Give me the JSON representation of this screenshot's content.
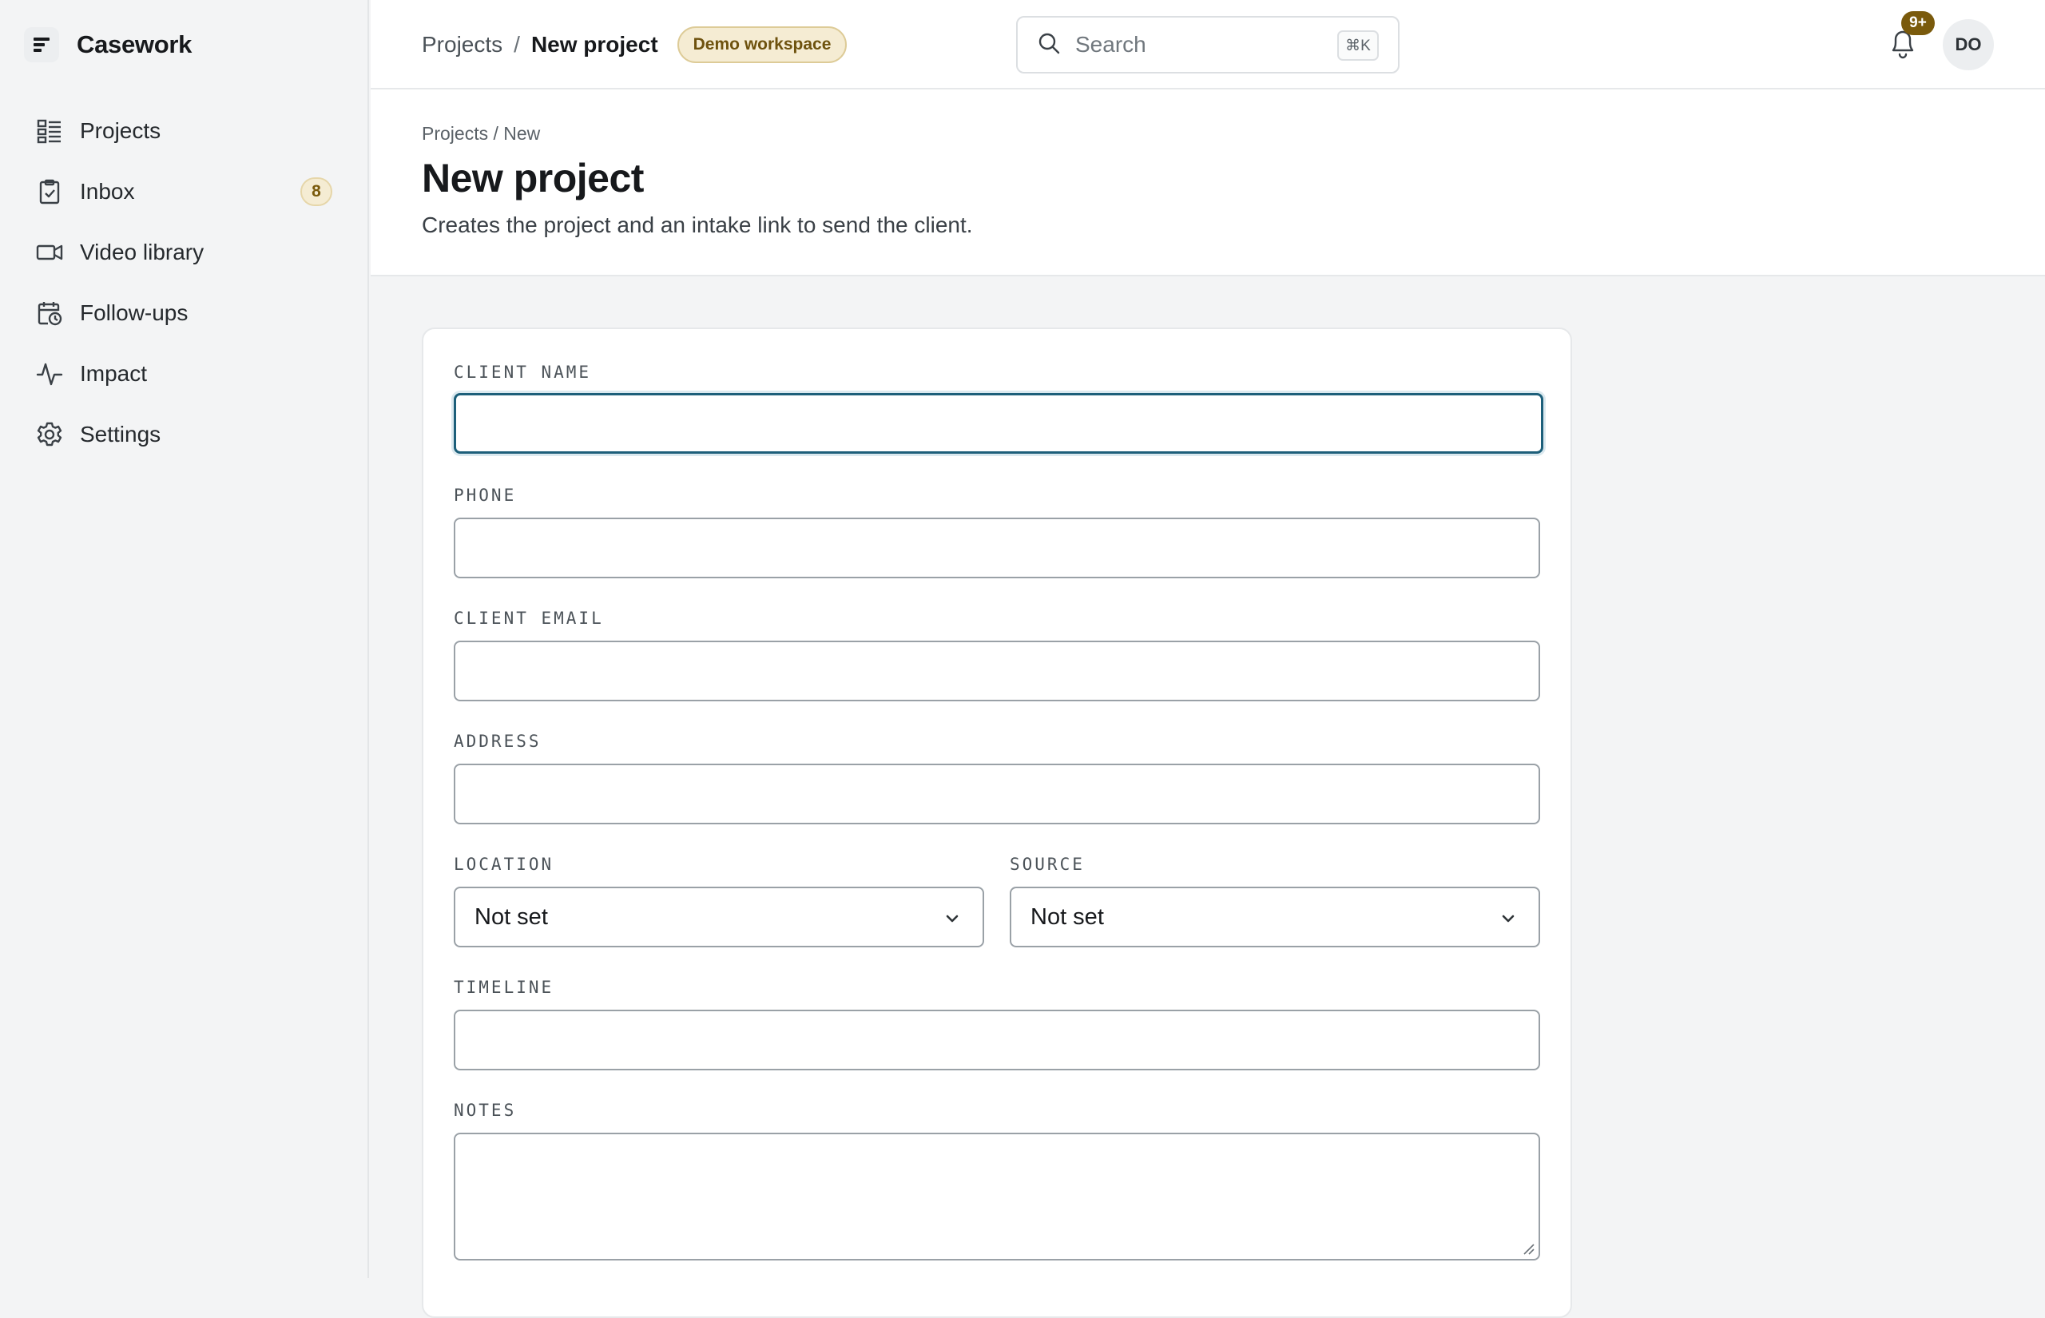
{
  "app": {
    "name": "Casework"
  },
  "sidebar": {
    "items": [
      {
        "label": "Projects"
      },
      {
        "label": "Inbox",
        "badge": "8"
      },
      {
        "label": "Video library"
      },
      {
        "label": "Follow-ups"
      },
      {
        "label": "Impact"
      },
      {
        "label": "Settings"
      }
    ]
  },
  "topbar": {
    "breadcrumb": {
      "parent": "Projects",
      "separator": "/",
      "current": "New project"
    },
    "workspace_badge": "Demo workspace",
    "search": {
      "placeholder": "Search",
      "shortcut": "⌘K"
    },
    "notifications": {
      "count": "9+"
    },
    "user": {
      "initials": "DO"
    }
  },
  "page": {
    "breadcrumb": "Projects / New",
    "title": "New project",
    "description": "Creates the project and an intake link to send the client."
  },
  "form": {
    "client_name": {
      "label": "CLIENT NAME",
      "value": ""
    },
    "phone": {
      "label": "PHONE",
      "value": ""
    },
    "client_email": {
      "label": "CLIENT EMAIL",
      "value": ""
    },
    "address": {
      "label": "ADDRESS",
      "value": ""
    },
    "location": {
      "label": "LOCATION",
      "selected": "Not set"
    },
    "source": {
      "label": "SOURCE",
      "selected": "Not set"
    },
    "timeline": {
      "label": "TIMELINE",
      "value": ""
    },
    "notes": {
      "label": "NOTES",
      "value": ""
    }
  },
  "colors": {
    "focus_ring": "#1d5f7a",
    "badge_bg": "#f5ecd3",
    "badge_text": "#6e520e",
    "notif_bg": "#7a5a0c"
  }
}
